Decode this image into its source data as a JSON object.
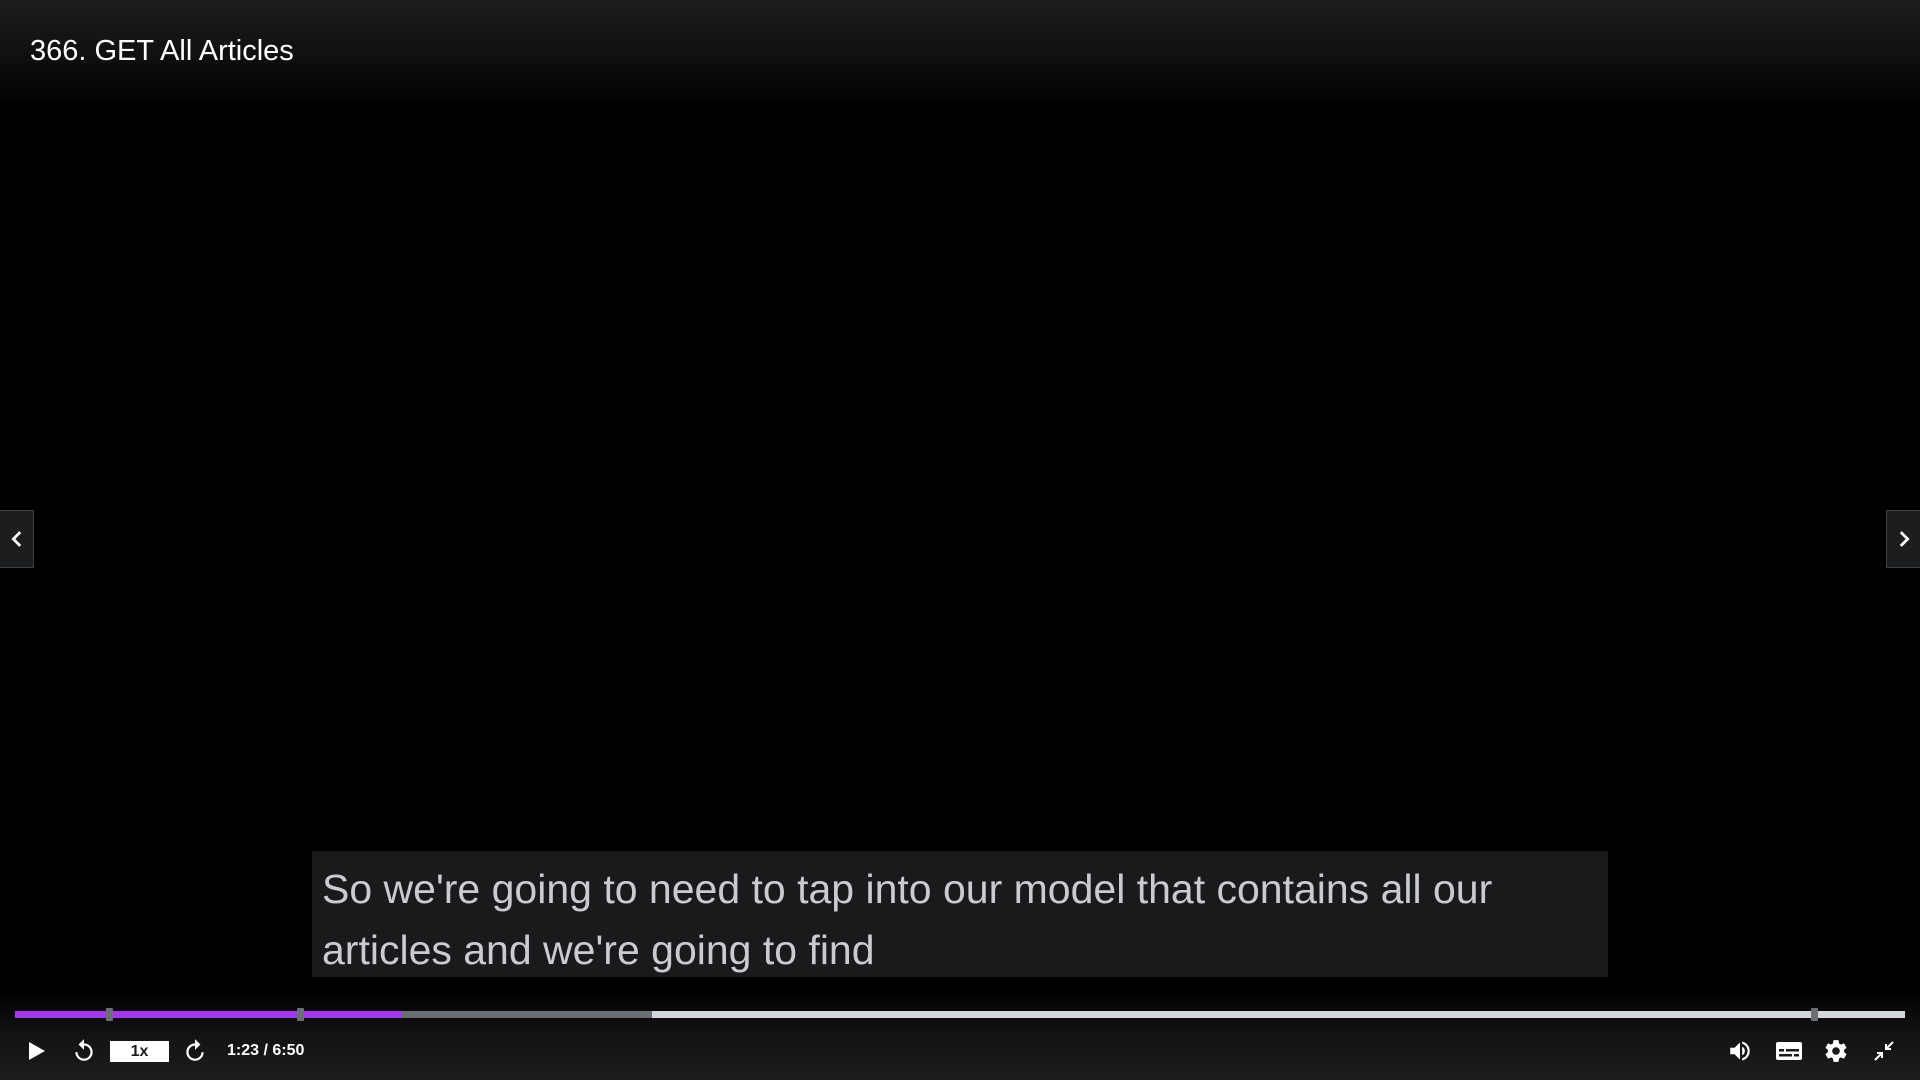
{
  "lecture": {
    "title": "366. GET All Articles"
  },
  "caption": {
    "line1": "So we're going to need to tap into our model that contains all our",
    "line2": "articles and we're going to find"
  },
  "player": {
    "playback_rate": "1x",
    "current_time": "1:23",
    "duration": "6:50",
    "time_display": "1:23 / 6:50",
    "progress_fraction": 0.205,
    "buffered_fraction": 0.337,
    "accent_color": "#a435f0"
  },
  "icons": {
    "prev": "chevron-left-icon",
    "next": "chevron-right-icon",
    "play": "play-icon",
    "rewind": "rewind-5-icon",
    "forward": "forward-5-icon",
    "volume": "volume-icon",
    "captions": "captions-icon",
    "settings": "gear-icon",
    "exit_fullscreen": "exit-fullscreen-icon"
  }
}
